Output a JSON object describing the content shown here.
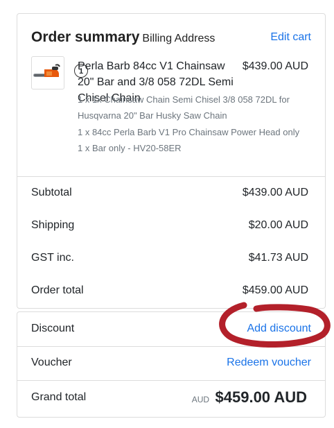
{
  "summary": {
    "title": "Order summary",
    "subtitle": "Billing Address",
    "edit_label": "Edit cart"
  },
  "item": {
    "quantity": "1",
    "name": "Perla Barb 84cc V1 Chainsaw 20\" Bar and 3/8 058 72DL Semi Chisel Chain",
    "price": "$439.00 AUD",
    "options": [
      "1 x 1x Chainsaw Chain Semi Chisel 3/8 058 72DL for Husqvarna 20\" Bar Husky Saw Chain",
      "1 x 84cc Perla Barb V1 Pro Chainsaw Power Head only",
      "1 x Bar only - HV20-58ER"
    ]
  },
  "totals": {
    "subtotal_label": "Subtotal",
    "subtotal_value": "$439.00 AUD",
    "shipping_label": "Shipping",
    "shipping_value": "$20.00 AUD",
    "gst_label": "GST inc.",
    "gst_value": "$41.73 AUD",
    "order_total_label": "Order total",
    "order_total_value": "$459.00 AUD"
  },
  "discount": {
    "label": "Discount",
    "link": "Add discount"
  },
  "voucher": {
    "label": "Voucher",
    "link": "Redeem voucher"
  },
  "grand_total": {
    "label": "Grand total",
    "currency": "AUD",
    "value": "$459.00 AUD"
  },
  "colors": {
    "link": "#1a73e8",
    "annotation": "#b3202a",
    "border": "#dcdcdc",
    "muted": "#6c757d"
  },
  "icons": {
    "product_thumbnail": "chainsaw-icon"
  }
}
